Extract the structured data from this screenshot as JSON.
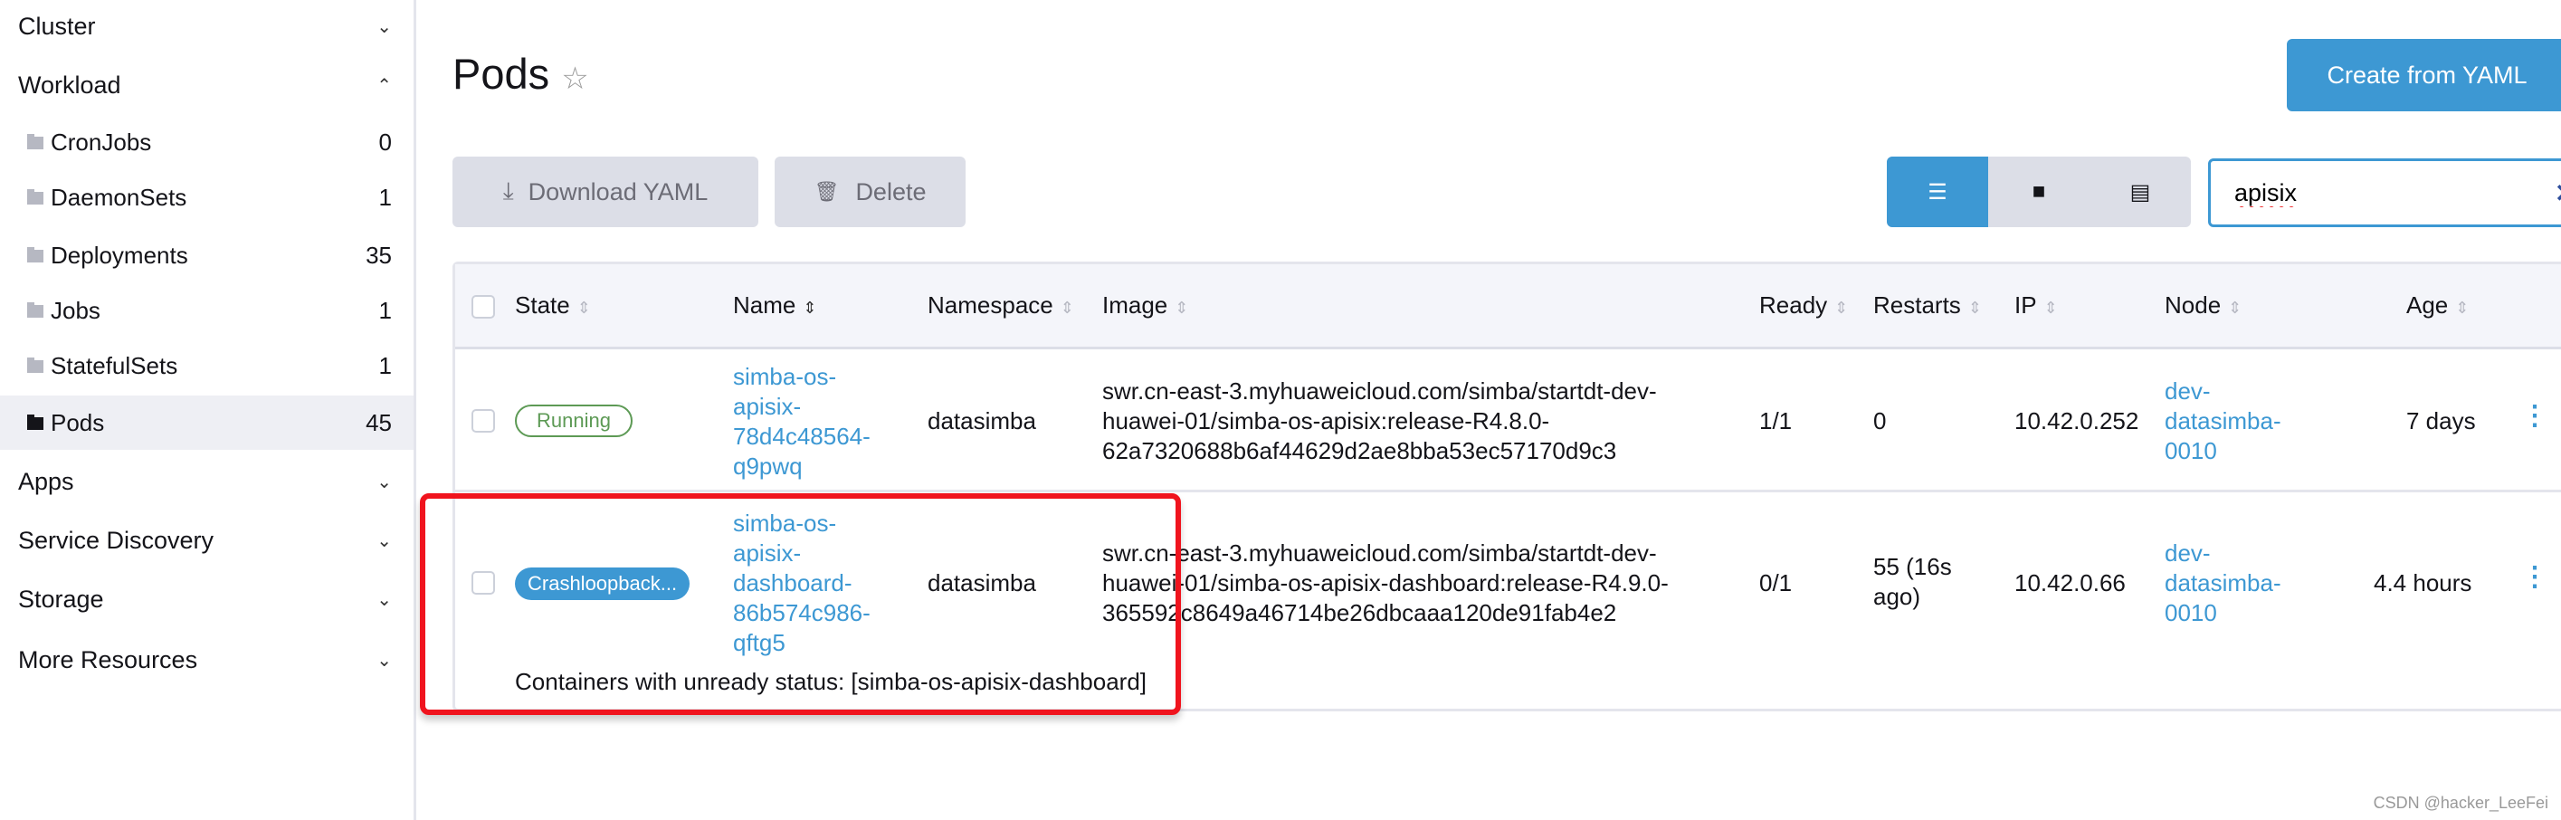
{
  "sidebar": {
    "groups": [
      {
        "label": "Cluster",
        "icon": "chevron-down"
      },
      {
        "label": "Workload",
        "icon": "chevron-up"
      },
      {
        "label": "Apps",
        "icon": "chevron-down"
      },
      {
        "label": "Service Discovery",
        "icon": "chevron-down"
      },
      {
        "label": "Storage",
        "icon": "chevron-down"
      },
      {
        "label": "More Resources",
        "icon": "chevron-down"
      }
    ],
    "items": [
      {
        "label": "CronJobs",
        "count": "0"
      },
      {
        "label": "DaemonSets",
        "count": "1"
      },
      {
        "label": "Deployments",
        "count": "35"
      },
      {
        "label": "Jobs",
        "count": "1"
      },
      {
        "label": "StatefulSets",
        "count": "1"
      },
      {
        "label": "Pods",
        "count": "45",
        "active": true
      }
    ]
  },
  "header": {
    "title": "Pods",
    "create_label": "Create from YAML"
  },
  "toolbar": {
    "download_label": "Download YAML",
    "delete_label": "Delete",
    "views": [
      "list-icon",
      "folder-icon",
      "server-icon"
    ],
    "search_value": "apisix"
  },
  "colors": {
    "accent": "#3d98d3",
    "running": "#5d9a55",
    "highlight": "#f0141e"
  },
  "table": {
    "columns": [
      "State",
      "Name",
      "Namespace",
      "Image",
      "Ready",
      "Restarts",
      "IP",
      "Node",
      "Age"
    ],
    "rows": [
      {
        "state": "Running",
        "name": [
          "simba-os-",
          "apisix-",
          "78d4c48564-",
          "q9pwq"
        ],
        "namespace": "datasimba",
        "image": [
          "swr.cn-east-3.myhuaweicloud.com/simba/startdt-dev-",
          "huawei-01/simba-os-apisix:release-R4.8.0-",
          "62a7320688b6af44629d2ae8bba53ec57170d9c3"
        ],
        "ready": "1/1",
        "restarts": [
          "0"
        ],
        "ip": "10.42.0.252",
        "node": [
          "dev-",
          "datasimba-",
          "0010"
        ],
        "age": "7 days"
      },
      {
        "state": "Crashloopback...",
        "name": [
          "simba-os-",
          "apisix-",
          "dashboard-",
          "86b574c986-",
          "qftg5"
        ],
        "namespace": "datasimba",
        "image": [
          "swr.cn-east-3.myhuaweicloud.com/simba/startdt-dev-",
          "huawei-01/simba-os-apisix-dashboard:release-R4.9.0-",
          "365592c8649a46714be26dbcaaa120de91fab4e2"
        ],
        "ready": "0/1",
        "restarts": [
          "55 (16s",
          "ago)"
        ],
        "ip": "10.42.0.66",
        "node": [
          "dev-",
          "datasimba-",
          "0010"
        ],
        "age": "4.4 hours",
        "message": "Containers with unready status: [simba-os-apisix-dashboard]"
      }
    ]
  },
  "watermark": "CSDN @hacker_LeeFei"
}
